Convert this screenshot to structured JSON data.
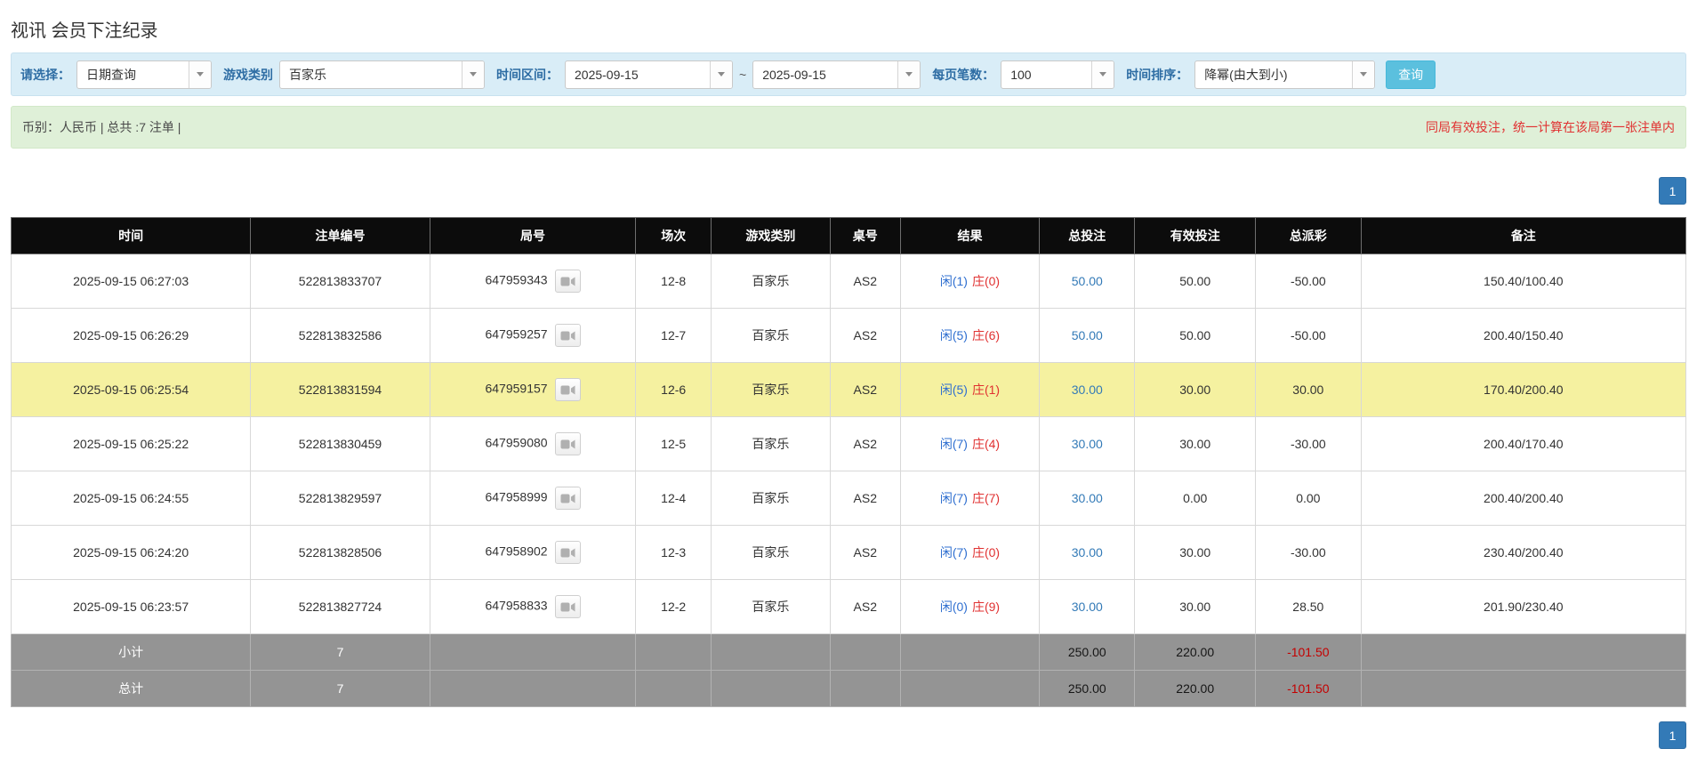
{
  "page": {
    "title": "视讯 会员下注纪录"
  },
  "colors": {
    "filter_bg": "#d9edf7",
    "summary_bg": "#dff0d8",
    "label_blue": "#2e6da4",
    "accent_blue": "#337ab7",
    "button_cyan": "#5bc0de",
    "header_bg": "#0c0c0c",
    "highlight_yellow": "#f5f1a0",
    "footer_gray": "#949494",
    "link_blue": "#337ab7",
    "player_blue": "#2f6fd0",
    "banker_red": "#e03131",
    "negative_red": "#e03131"
  },
  "filters": {
    "select_label": "请选择：",
    "select_value": "日期查询",
    "game_label": "游戏类别",
    "game_value": "百家乐",
    "range_label": "时间区间：",
    "date_from": "2025-09-15",
    "range_separator": "~",
    "date_to": "2025-09-15",
    "pagesize_label": "每页笔数：",
    "pagesize_value": "100",
    "sort_label": "时间排序：",
    "sort_value": "降幂(由大到小)",
    "search_label": "查询"
  },
  "summary": {
    "left_text": "币别：人民币 | 总共 :7 注单 |",
    "right_notice": "同局有效投注，统一计算在该局第一张注单内"
  },
  "pagination": {
    "page": "1"
  },
  "table": {
    "headers": [
      "时间",
      "注单编号",
      "局号",
      "场次",
      "游戏类别",
      "桌号",
      "结果",
      "总投注",
      "有效投注",
      "总派彩",
      "备注"
    ],
    "rows": [
      {
        "time": "2025-09-15 06:27:03",
        "bet_id": "522813833707",
        "round_id": "647959343",
        "session": "12-8",
        "game": "百家乐",
        "table_no": "AS2",
        "result_player": "闲(1)",
        "result_banker": "庄(0)",
        "total_bet": "50.00",
        "valid_bet": "50.00",
        "payout": "-50.00",
        "remark": "150.40/100.40",
        "highlight": false
      },
      {
        "time": "2025-09-15 06:26:29",
        "bet_id": "522813832586",
        "round_id": "647959257",
        "session": "12-7",
        "game": "百家乐",
        "table_no": "AS2",
        "result_player": "闲(5)",
        "result_banker": "庄(6)",
        "total_bet": "50.00",
        "valid_bet": "50.00",
        "payout": "-50.00",
        "remark": "200.40/150.40",
        "highlight": false
      },
      {
        "time": "2025-09-15 06:25:54",
        "bet_id": "522813831594",
        "round_id": "647959157",
        "session": "12-6",
        "game": "百家乐",
        "table_no": "AS2",
        "result_player": "闲(5)",
        "result_banker": "庄(1)",
        "total_bet": "30.00",
        "valid_bet": "30.00",
        "payout": "30.00",
        "remark": "170.40/200.40",
        "highlight": true
      },
      {
        "time": "2025-09-15 06:25:22",
        "bet_id": "522813830459",
        "round_id": "647959080",
        "session": "12-5",
        "game": "百家乐",
        "table_no": "AS2",
        "result_player": "闲(7)",
        "result_banker": "庄(4)",
        "total_bet": "30.00",
        "valid_bet": "30.00",
        "payout": "-30.00",
        "remark": "200.40/170.40",
        "highlight": false
      },
      {
        "time": "2025-09-15 06:24:55",
        "bet_id": "522813829597",
        "round_id": "647958999",
        "session": "12-4",
        "game": "百家乐",
        "table_no": "AS2",
        "result_player": "闲(7)",
        "result_banker": "庄(7)",
        "total_bet": "30.00",
        "valid_bet": "0.00",
        "payout": "0.00",
        "remark": "200.40/200.40",
        "highlight": false
      },
      {
        "time": "2025-09-15 06:24:20",
        "bet_id": "522813828506",
        "round_id": "647958902",
        "session": "12-3",
        "game": "百家乐",
        "table_no": "AS2",
        "result_player": "闲(7)",
        "result_banker": "庄(0)",
        "total_bet": "30.00",
        "valid_bet": "30.00",
        "payout": "-30.00",
        "remark": "230.40/200.40",
        "highlight": false
      },
      {
        "time": "2025-09-15 06:23:57",
        "bet_id": "522813827724",
        "round_id": "647958833",
        "session": "12-2",
        "game": "百家乐",
        "table_no": "AS2",
        "result_player": "闲(0)",
        "result_banker": "庄(9)",
        "total_bet": "30.00",
        "valid_bet": "30.00",
        "payout": "28.50",
        "remark": "201.90/230.40",
        "highlight": false
      }
    ],
    "footer": [
      {
        "label": "小计",
        "count": "7",
        "total_bet": "250.00",
        "valid_bet": "220.00",
        "payout": "-101.50"
      },
      {
        "label": "总计",
        "count": "7",
        "total_bet": "250.00",
        "valid_bet": "220.00",
        "payout": "-101.50"
      }
    ]
  }
}
